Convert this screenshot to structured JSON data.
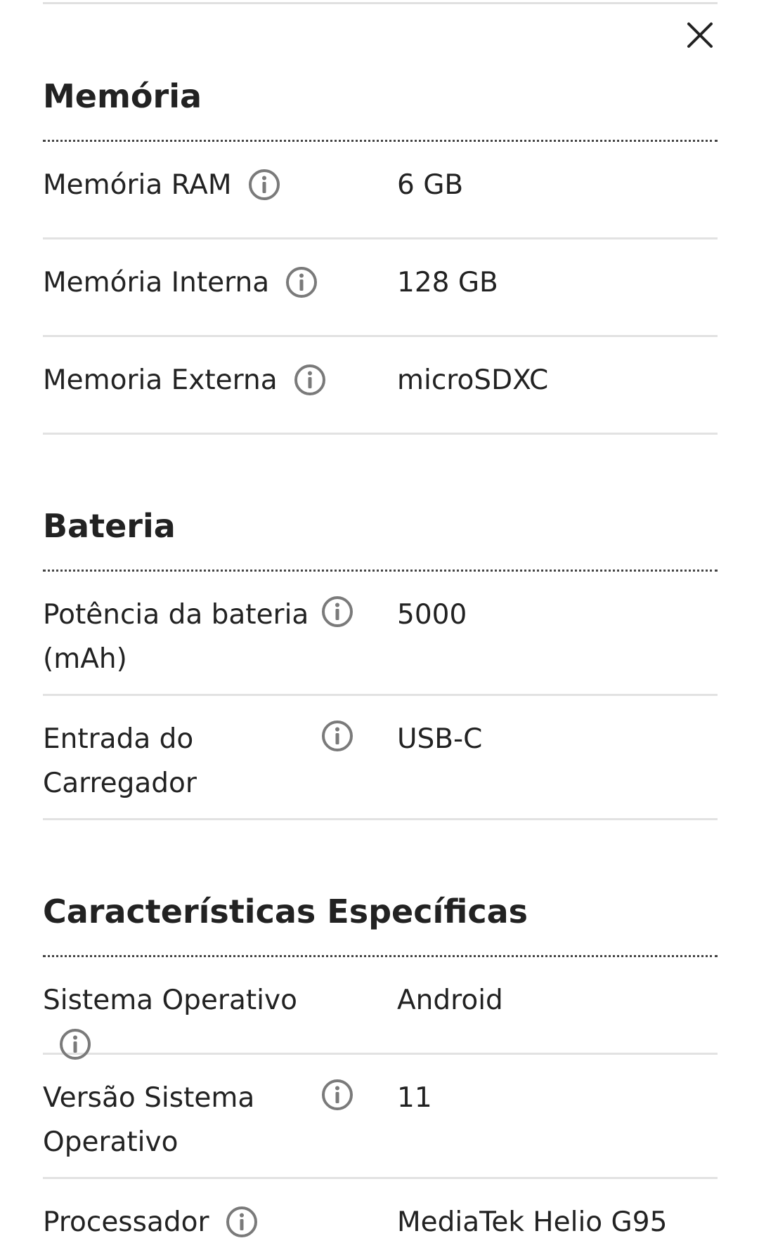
{
  "close_icon": "close-icon",
  "info_icon": "info-icon",
  "sections": [
    {
      "title": "Memória",
      "rows": [
        {
          "label": "Memória RAM",
          "value": "6 GB"
        },
        {
          "label": "Memória Interna",
          "value": "128 GB"
        },
        {
          "label": "Memoria Externa",
          "value": "microSDXC"
        }
      ]
    },
    {
      "title": "Bateria",
      "rows": [
        {
          "label": "Potência da bateria (mAh)",
          "value": "5000"
        },
        {
          "label": "Entrada do Carregador",
          "value": "USB-C"
        }
      ]
    },
    {
      "title": "Características Específicas",
      "rows": [
        {
          "label": "Sistema Operativo",
          "value": "Android"
        },
        {
          "label": "Versão Sistema Operativo",
          "value": "11"
        },
        {
          "label": "Processador",
          "value": "MediaTek Helio G95"
        }
      ]
    }
  ]
}
